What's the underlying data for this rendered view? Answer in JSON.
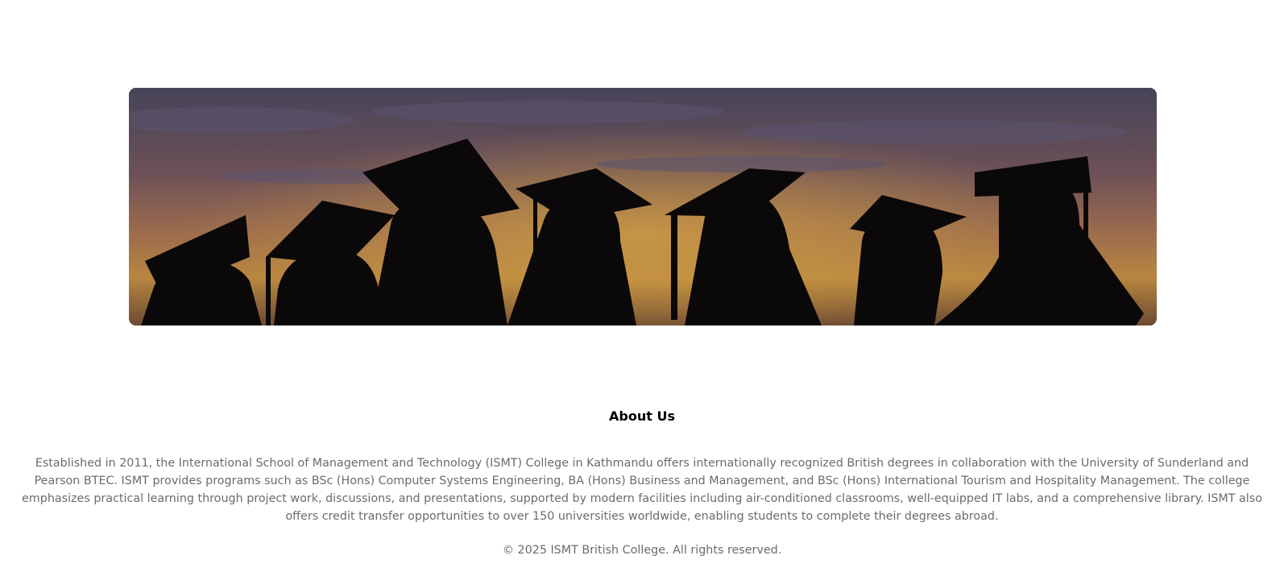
{
  "hero": {
    "image_alt": "Silhouettes of graduates wearing mortarboard caps against a sunset sky",
    "colors": {
      "sky_top": "#4b4a63",
      "sky_mid": "#8a5e54",
      "sky_glow": "#c79646",
      "silhouette": "#0b0809"
    }
  },
  "about": {
    "title": "About Us",
    "body": "Established in 2011, the International School of Management and Technology (ISMT) College in Kathmandu offers internationally recognized British degrees in collaboration with the University of Sunderland and Pearson BTEC. ISMT provides programs such as BSc (Hons) Computer Systems Engineering, BA (Hons) Business and Management, and BSc (Hons) International Tourism and Hospitality Management. The college emphasizes practical learning through project work, discussions, and presentations, supported by modern facilities including air-conditioned classrooms, well-equipped IT labs, and a comprehensive library. ISMT also offers credit transfer opportunities to over 150 universities worldwide, enabling students to complete their degrees abroad."
  },
  "footer": {
    "copyright": "© 2025 ISMT British College. All rights reserved."
  }
}
